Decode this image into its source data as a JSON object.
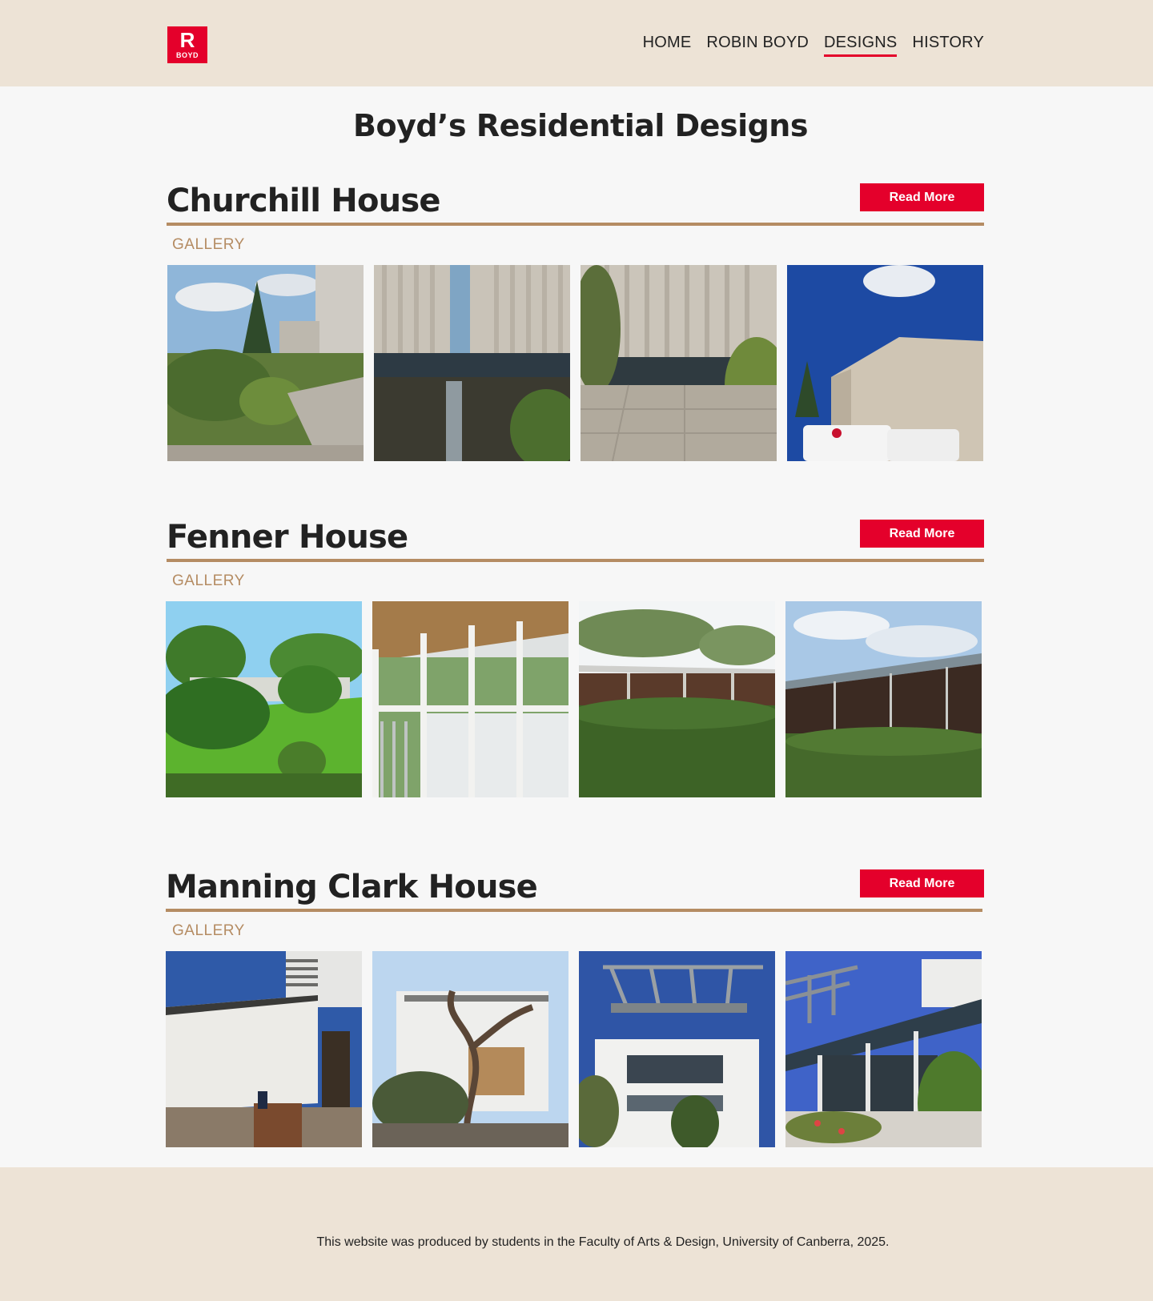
{
  "header": {
    "logo": {
      "letter": "R",
      "word": "BOYD"
    },
    "nav": [
      {
        "label": "HOME",
        "active": false
      },
      {
        "label": "ROBIN BOYD",
        "active": false
      },
      {
        "label": "DESIGNS",
        "active": true
      },
      {
        "label": "HISTORY",
        "active": false
      }
    ]
  },
  "page": {
    "title": "Boyd’s Residential Designs"
  },
  "houses": [
    {
      "name": "Churchill House",
      "button": "Read More",
      "gallery_label": "GALLERY",
      "photos": [
        "photo-courtyard-garden",
        "photo-reflecting-pool",
        "photo-paved-courtyard",
        "photo-exterior-with-vans"
      ]
    },
    {
      "name": "Fenner House",
      "button": "Read More",
      "gallery_label": "GALLERY",
      "photos": [
        "photo-house-on-lawn",
        "photo-window-wall",
        "photo-roofline-hedge",
        "photo-eaves-sky"
      ]
    },
    {
      "name": "Manning Clark House",
      "button": "Read More",
      "gallery_label": "GALLERY",
      "photos": [
        "photo-white-brick-corner",
        "photo-vine-pergola",
        "photo-facade-pergola",
        "photo-verandah-garden"
      ]
    }
  ],
  "footer": {
    "text": "This website was produced by students in the Faculty of Arts & Design, University of Canberra, 2025."
  }
}
